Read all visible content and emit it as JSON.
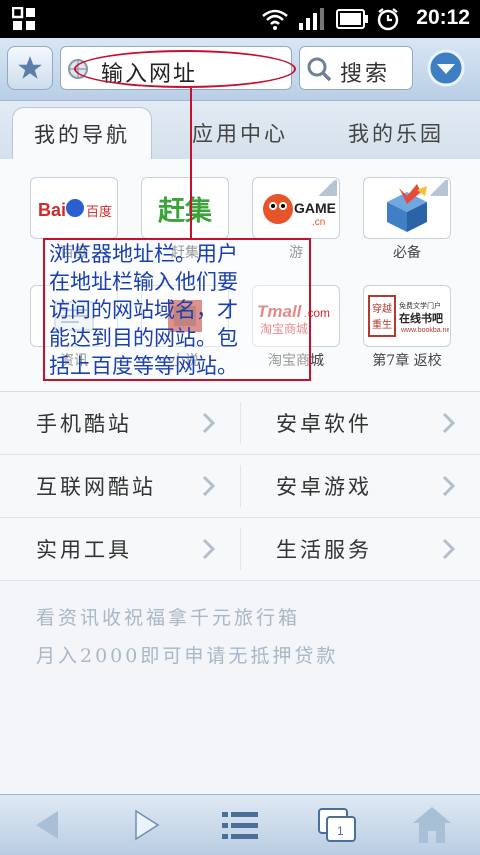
{
  "status_bar": {
    "time": "20:12"
  },
  "toolbar": {
    "url_placeholder": "输入网址",
    "search_label": "搜索"
  },
  "tabs": [
    {
      "label": "我的导航",
      "active": true
    },
    {
      "label": "应用中心",
      "active": false
    },
    {
      "label": "我的乐园",
      "active": false
    }
  ],
  "apps": [
    {
      "name": "百度",
      "logo_text": "Bai百度",
      "caption": "百度",
      "icon": "baidu-logo"
    },
    {
      "name": "赶集",
      "logo_text": "赶集",
      "caption": "赶集",
      "icon": "ganji-logo"
    },
    {
      "name": "游",
      "logo_text": "GAME.cn",
      "caption": "游",
      "icon": "game-logo"
    },
    {
      "name": "必备",
      "logo_text": "",
      "caption": "必备",
      "icon": "app-box-icon"
    },
    {
      "name": "资讯",
      "logo_text": "",
      "caption": "资讯",
      "icon": "news-icon"
    },
    {
      "name": "小说",
      "logo_text": "",
      "caption": "小说",
      "icon": "novel-icon"
    },
    {
      "name": "淘宝商城",
      "logo_text": "Tmall.com 淘宝商城",
      "caption": "淘宝商城",
      "icon": "tmall-logo"
    },
    {
      "name": "第7章 返校",
      "logo_text": "在线书吧",
      "caption": "第7章 返校",
      "icon": "bookba-logo"
    }
  ],
  "links": [
    [
      "手机酷站",
      "安卓软件"
    ],
    [
      "互联网酷站",
      "安卓游戏"
    ],
    [
      "实用工具",
      "生活服务"
    ]
  ],
  "ads": [
    "看资讯收祝福拿千元旅行箱",
    "月入2000即可申请无抵押贷款"
  ],
  "annotation": {
    "lines": [
      "浏览器地址栏。用户",
      "在地址栏输入他们要",
      "访问的网站域名，才",
      "能达到目的网站。包",
      "括上百度等等网站。"
    ]
  }
}
